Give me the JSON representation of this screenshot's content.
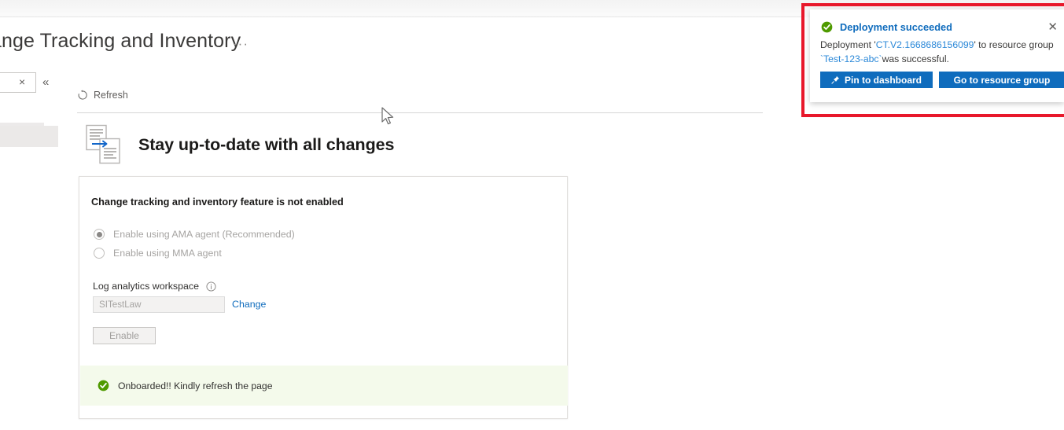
{
  "page": {
    "title": "ange Tracking and Inventory",
    "title_overflow_menu": "···"
  },
  "rail": {
    "search_clear_label": "×",
    "collapse_label": "«"
  },
  "command_bar": {
    "refresh_label": "Refresh",
    "refresh_icon": "refresh-icon"
  },
  "hero": {
    "icon": "change-tracking-documents-icon",
    "title": "Stay up-to-date with all changes"
  },
  "card": {
    "heading": "Change tracking and inventory feature is not enabled",
    "options": [
      {
        "label": "Enable using AMA agent (Recommended)",
        "selected": true
      },
      {
        "label": "Enable using MMA agent",
        "selected": false
      }
    ],
    "workspace_field": {
      "label": "Log analytics workspace",
      "info_icon": "info-circle-icon",
      "value": "SITestLaw",
      "placeholder": "SITestLaw",
      "change_link": "Change"
    },
    "enable_button": "Enable",
    "status_banner": {
      "icon": "success-check-icon",
      "text": "Onboarded!! Kindly refresh the page",
      "background": "#f4faeb"
    }
  },
  "notification": {
    "status_icon": "success-check-icon",
    "title": "Deployment succeeded",
    "close_label": "✕",
    "body_prefix": "Deployment '",
    "deployment_name": "CT.V2.1668686156099",
    "body_middle": "' to resource group ",
    "resource_group": "`Test-123-abc`",
    "body_suffix": "was successful.",
    "buttons": {
      "pin_label": "Pin to dashboard",
      "pin_icon": "pin-icon",
      "goto_label": "Go to resource group"
    },
    "highlight_border_color": "#e8182b"
  },
  "colors": {
    "accent_blue": "#0f6cbd",
    "link_blue": "#2b88d8",
    "success_green": "#57a300",
    "highlight_red": "#e8182b"
  }
}
